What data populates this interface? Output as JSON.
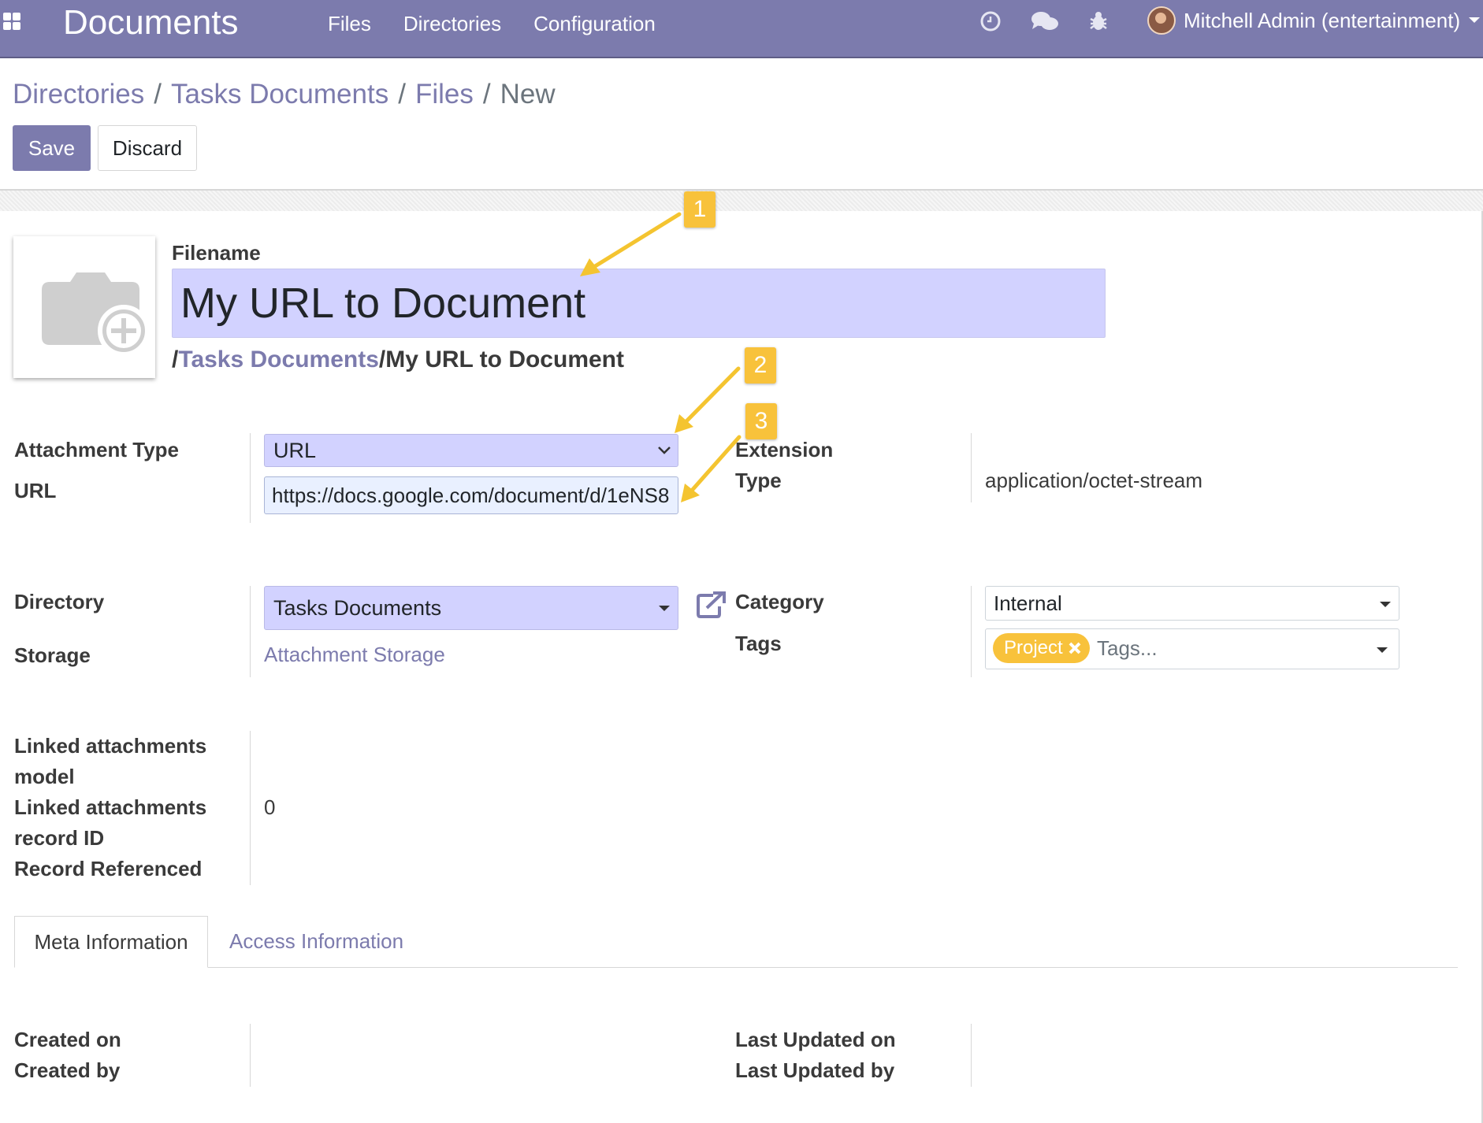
{
  "navbar": {
    "app_title": "Documents",
    "menu": [
      "Files",
      "Directories",
      "Configuration"
    ],
    "user": "Mitchell Admin (entertainment)",
    "brand_color": "#7c7bad"
  },
  "breadcrumb": [
    "Directories",
    "Tasks Documents",
    "Files",
    "New"
  ],
  "actions": {
    "save": "Save",
    "discard": "Discard"
  },
  "form": {
    "filename_label": "Filename",
    "filename_value": "My URL to Document",
    "path_prefix": "/",
    "path_link": "Tasks Documents",
    "path_suffix": "/My URL to Document",
    "attachment_type_label": "Attachment Type",
    "attachment_type_value": "URL",
    "url_label": "URL",
    "url_value": "https://docs.google.com/document/d/1eNS8",
    "extension_label": "Extension",
    "type_label": "Type",
    "type_value": "application/octet-stream",
    "directory_label": "Directory",
    "directory_value": "Tasks Documents",
    "storage_label": "Storage",
    "storage_value": "Attachment Storage",
    "category_label": "Category",
    "category_value": "Internal",
    "tags_label": "Tags",
    "tag_chip": "Project",
    "tags_placeholder": "Tags...",
    "linked_model_label_1": "Linked attachments",
    "linked_model_label_2": "model",
    "linked_record_label_1": "Linked attachments",
    "linked_record_label_2": "record ID",
    "linked_record_value": "0",
    "record_referenced_label": "Record Referenced"
  },
  "tabs": [
    "Meta Information",
    "Access Information"
  ],
  "meta": {
    "created_on": "Created on",
    "created_by": "Created by",
    "last_updated_on": "Last Updated on",
    "last_updated_by": "Last Updated by"
  },
  "annotations": [
    "1",
    "2",
    "3"
  ],
  "annotation_color": "#f8c23b"
}
